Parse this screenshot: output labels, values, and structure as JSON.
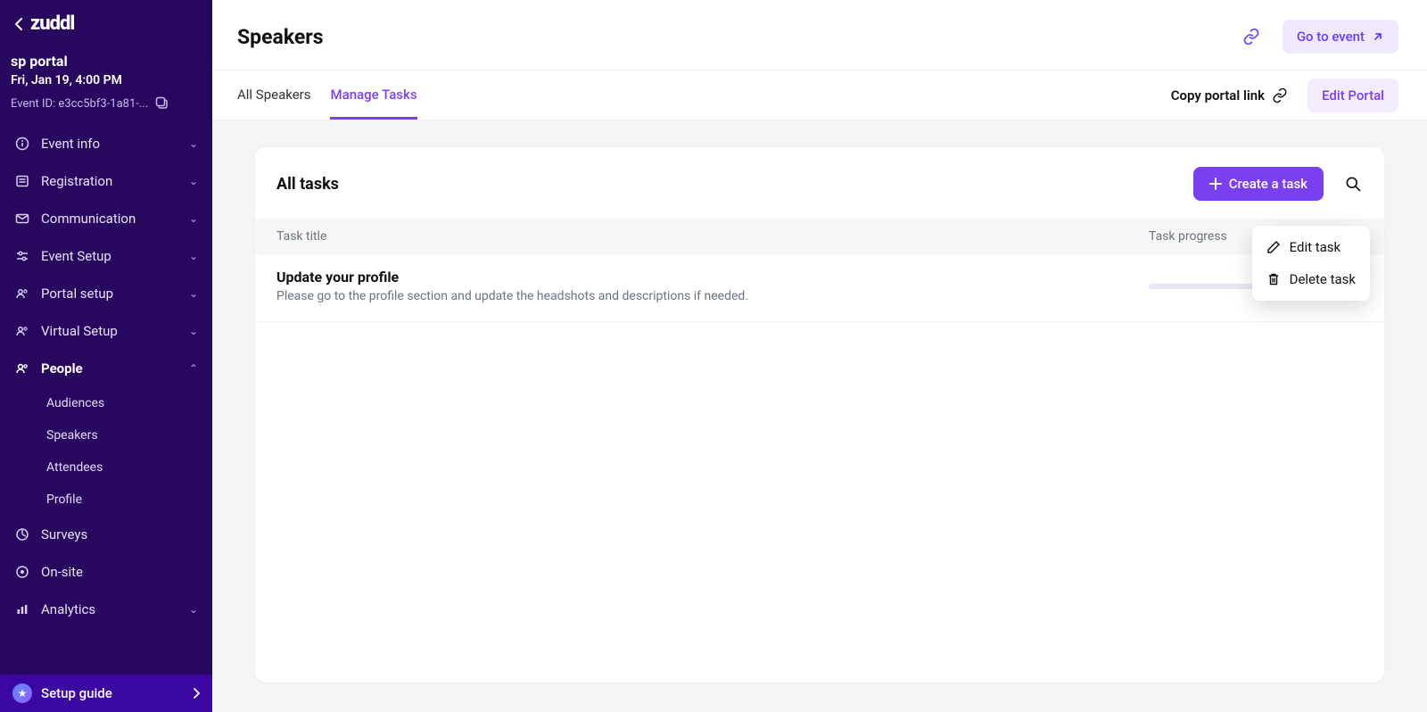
{
  "brand": "zuddl",
  "portal": {
    "name": "sp portal",
    "date": "Fri, Jan 19, 4:00 PM",
    "event_id_label": "Event ID: e3cc5bf3-1a81-..."
  },
  "sidebar": {
    "items": [
      {
        "label": "Event info",
        "expanded": false
      },
      {
        "label": "Registration",
        "expanded": false
      },
      {
        "label": "Communication",
        "expanded": false
      },
      {
        "label": "Event Setup",
        "expanded": false
      },
      {
        "label": "Portal setup",
        "expanded": false
      },
      {
        "label": "Virtual Setup",
        "expanded": false
      },
      {
        "label": "People",
        "expanded": true,
        "children": [
          "Audiences",
          "Speakers",
          "Attendees",
          "Profile"
        ]
      },
      {
        "label": "Surveys",
        "expanded": false
      },
      {
        "label": "On-site",
        "expanded": false
      },
      {
        "label": "Analytics",
        "expanded": false
      }
    ],
    "footer_label": "Setup guide"
  },
  "header": {
    "title": "Speakers",
    "go_event": "Go to event"
  },
  "tabs": {
    "all_speakers": "All Speakers",
    "manage_tasks": "Manage Tasks",
    "copy_portal": "Copy portal link",
    "edit_portal": "Edit Portal"
  },
  "tasks": {
    "section_title": "All tasks",
    "create_label": "Create a task",
    "col_title": "Task title",
    "col_progress": "Task progress",
    "rows": [
      {
        "title": "Update your profile",
        "desc": "Please go to the profile section and update the headshots and descriptions if needed."
      }
    ],
    "ctx": {
      "edit": "Edit task",
      "delete": "Delete task"
    }
  }
}
